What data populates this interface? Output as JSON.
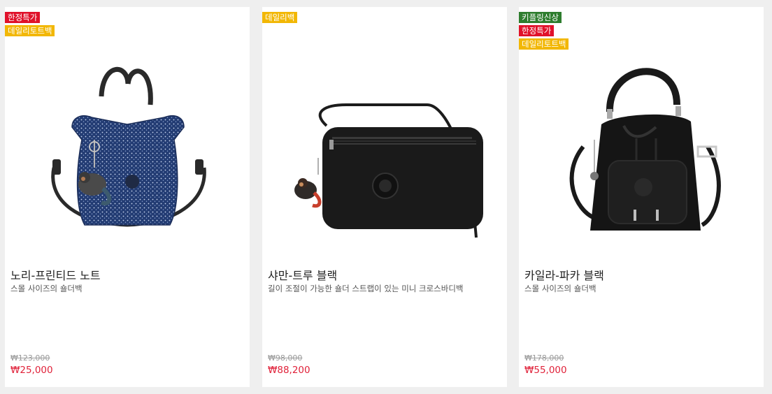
{
  "colors": {
    "badge_red": "#e0112a",
    "badge_yellow": "#f2b705",
    "badge_green": "#2e7d2e",
    "price_red": "#e0223a"
  },
  "products": [
    {
      "badges": [
        {
          "label": "한정특가",
          "color": "#e0112a"
        },
        {
          "label": "데일리토트백",
          "color": "#f2b705"
        }
      ],
      "image": "tote-bag-icon",
      "name": "노리-프린티드 노트",
      "description": "스몰 사이즈의 숄더백",
      "original_price": "₩123,000",
      "sale_price": "₩25,000"
    },
    {
      "badges": [
        {
          "label": "데일리백",
          "color": "#f2b705"
        }
      ],
      "image": "crossbody-bag-icon",
      "name": "샤만-트루 블랙",
      "description": "길이 조절이 가능한 숄더 스트랩이 있는 미니 크로스바디백",
      "original_price": "₩98,000",
      "sale_price": "₩88,200"
    },
    {
      "badges": [
        {
          "label": "키플링신상",
          "color": "#2e7d2e"
        },
        {
          "label": "한정특가",
          "color": "#e0112a"
        },
        {
          "label": "데일리토트백",
          "color": "#f2b705"
        }
      ],
      "image": "bucket-bag-icon",
      "name": "카일라-파카 블랙",
      "description": "스몰 사이즈의 숄더백",
      "original_price": "₩178,000",
      "sale_price": "₩55,000"
    }
  ]
}
